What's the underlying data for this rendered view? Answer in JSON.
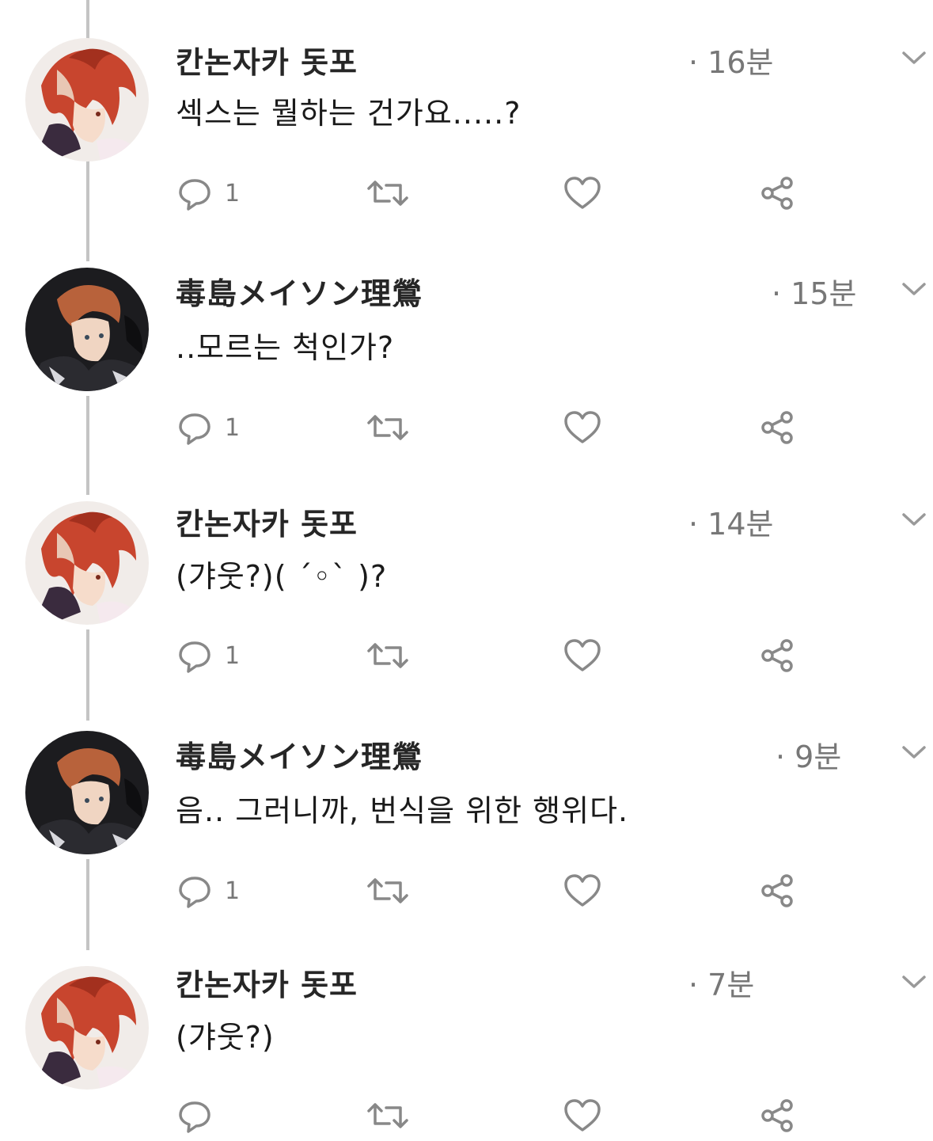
{
  "tweets": [
    {
      "avatar": "red-hair-avatar",
      "username": "칸논자카 돗포",
      "time": "· 16분",
      "text": "섹스는 뭘하는 건가요.....?",
      "reply_count": "1"
    },
    {
      "avatar": "dark-avatar",
      "username": "毒島メイソン理鶯",
      "time": "· 15분",
      "text": "..모르는 척인가?",
      "reply_count": "1"
    },
    {
      "avatar": "red-hair-avatar",
      "username": "칸논자카 돗포",
      "time": "· 14분",
      "text": "(갸웃?)( ´◦` )?",
      "reply_count": "1"
    },
    {
      "avatar": "dark-avatar",
      "username": "毒島メイソン理鶯",
      "time": "· 9분",
      "text": "음.. 그러니까, 번식을 위한 행위다.",
      "reply_count": "1"
    },
    {
      "avatar": "red-hair-avatar",
      "username": "칸논자카 돗포",
      "time": "· 7분",
      "text": "(갸웃?)",
      "reply_count": ""
    }
  ],
  "icons": {
    "reply": "speech-bubble-icon",
    "retweet": "retweet-icon",
    "like": "heart-icon",
    "share": "share-icon",
    "menu": "chevron-down-icon"
  },
  "colors": {
    "thread_line": "#c4c4c4",
    "icon_gray": "#888888",
    "text": "#1a1a1a",
    "meta": "#777777"
  }
}
